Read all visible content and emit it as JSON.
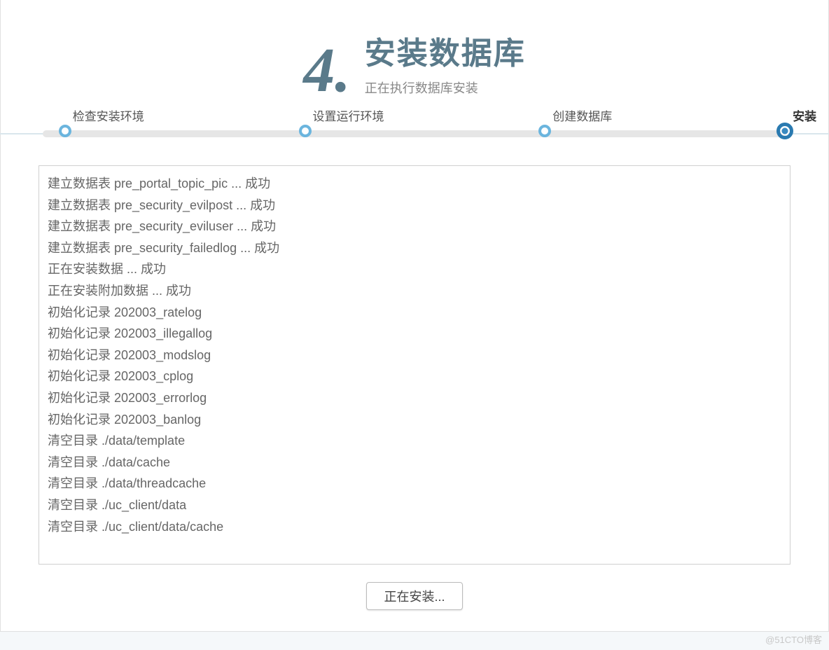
{
  "header": {
    "step_number": "4.",
    "title": "安装数据库",
    "subtitle": "正在执行数据库安装"
  },
  "progress": {
    "steps": [
      {
        "label": "检查安装环境",
        "position": 7,
        "active": false
      },
      {
        "label": "设置运行环境",
        "position": 36,
        "active": false
      },
      {
        "label": "创建数据库",
        "position": 65,
        "active": false
      },
      {
        "label": "安装",
        "position": 94,
        "active": true
      }
    ]
  },
  "log_lines": [
    "建立数据表 pre_portal_topic_pic ... 成功",
    "建立数据表 pre_security_evilpost ... 成功",
    "建立数据表 pre_security_eviluser ... 成功",
    "建立数据表 pre_security_failedlog ... 成功",
    "正在安装数据 ... 成功",
    "正在安装附加数据 ... 成功",
    "初始化记录 202003_ratelog",
    "初始化记录 202003_illegallog",
    "初始化记录 202003_modslog",
    "初始化记录 202003_cplog",
    "初始化记录 202003_errorlog",
    "初始化记录 202003_banlog",
    "清空目录 ./data/template",
    "清空目录 ./data/cache",
    "清空目录 ./data/threadcache",
    "清空目录 ./uc_client/data",
    "清空目录 ./uc_client/data/cache"
  ],
  "button": {
    "label": "正在安装..."
  },
  "watermark": "@51CTO博客"
}
